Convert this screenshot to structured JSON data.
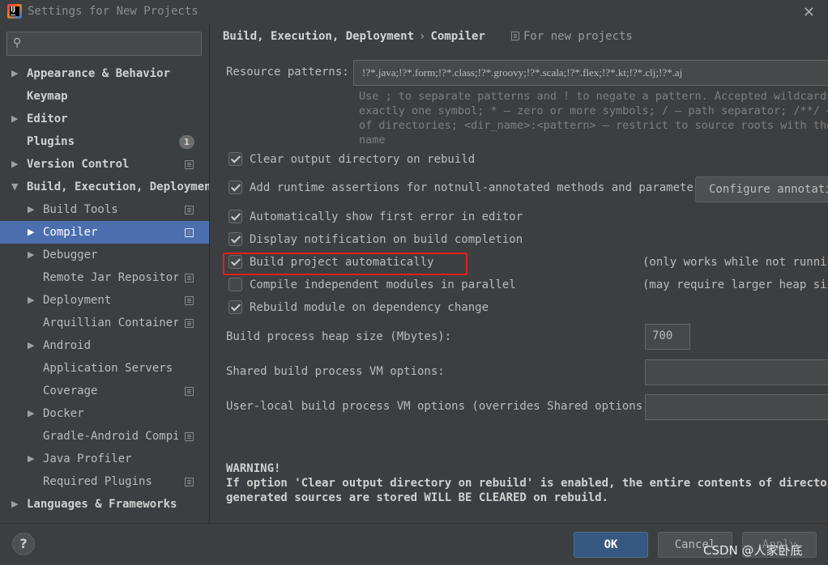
{
  "window": {
    "title": "Settings for New Projects",
    "close_glyph": "✕",
    "app_icon": "intellij-idea-icon"
  },
  "search": {
    "placeholder": "",
    "value": "",
    "icon": "search-icon",
    "icon_glyph": "⚲"
  },
  "sidebar": {
    "items": [
      {
        "label": "Appearance & Behavior",
        "level": 0,
        "arrow": "▶",
        "bold": true
      },
      {
        "label": "Keymap",
        "level": 0,
        "arrow": "",
        "bold": true
      },
      {
        "label": "Editor",
        "level": 0,
        "arrow": "▶",
        "bold": true
      },
      {
        "label": "Plugins",
        "level": 0,
        "arrow": "",
        "bold": true,
        "badge": "1"
      },
      {
        "label": "Version Control",
        "level": 0,
        "arrow": "▶",
        "bold": true,
        "copy_icon": true
      },
      {
        "label": "Build, Execution, Deployment",
        "level": 0,
        "arrow": "▼",
        "bold": true
      },
      {
        "label": "Build Tools",
        "level": 1,
        "arrow": "▶",
        "copy_icon": true
      },
      {
        "label": "Compiler",
        "level": 1,
        "arrow": "▶",
        "copy_icon": true,
        "selected": true
      },
      {
        "label": "Debugger",
        "level": 1,
        "arrow": "▶"
      },
      {
        "label": "Remote Jar Repositories",
        "level": 1,
        "arrow": "",
        "copy_icon": true
      },
      {
        "label": "Deployment",
        "level": 1,
        "arrow": "▶",
        "copy_icon": true
      },
      {
        "label": "Arquillian Containers",
        "level": 1,
        "arrow": "",
        "copy_icon": true
      },
      {
        "label": "Android",
        "level": 1,
        "arrow": "▶"
      },
      {
        "label": "Application Servers",
        "level": 1,
        "arrow": ""
      },
      {
        "label": "Coverage",
        "level": 1,
        "arrow": "",
        "copy_icon": true
      },
      {
        "label": "Docker",
        "level": 1,
        "arrow": "▶"
      },
      {
        "label": "Gradle-Android Compiler",
        "level": 1,
        "arrow": "",
        "copy_icon": true
      },
      {
        "label": "Java Profiler",
        "level": 1,
        "arrow": "▶"
      },
      {
        "label": "Required Plugins",
        "level": 1,
        "arrow": "",
        "copy_icon": true
      },
      {
        "label": "Languages & Frameworks",
        "level": 0,
        "arrow": "▶",
        "bold": true
      }
    ]
  },
  "header": {
    "crumb1": "Build, Execution, Deployment",
    "separator": "›",
    "crumb2": "Compiler",
    "scope": "For new projects"
  },
  "compiler": {
    "resource_patterns_label": "Resource patterns:",
    "resource_patterns_value": "!?*.java;!?*.form;!?*.class;!?*.groovy;!?*.scala;!?*.flex;!?*.kt;!?*.clj;!?*.aj",
    "hint_lines": [
      "Use ; to separate patterns and ! to negate a pattern. Accepted wildcards",
      "exactly one symbol; * — zero or more symbols; / — path separator; /**/ —",
      "of directories; <dir_name>:<pattern> — restrict to source roots with the",
      "name"
    ],
    "options": [
      {
        "label": "Clear output directory on rebuild",
        "checked": true
      },
      {
        "label": "Add runtime assertions for notnull-annotated methods and parameters",
        "checked": true
      },
      {
        "label": "Automatically show first error in editor",
        "checked": true
      },
      {
        "label": "Display notification on build completion",
        "checked": true
      },
      {
        "label": "Build project automatically",
        "checked": true
      },
      {
        "label": "Compile independent modules in parallel",
        "checked": false
      },
      {
        "label": "Rebuild module on dependency change",
        "checked": true
      }
    ],
    "configure_annotations_button": "Configure annotations...",
    "build_auto_note": "(only works while not running / debugging)",
    "parallel_note": "(may require larger heap size)",
    "heap_label": "Build process heap size (Mbytes):",
    "heap_value": "700",
    "shared_vm_label": "Shared build process VM options:",
    "shared_vm_value": "",
    "user_vm_label": "User-local build process VM options (overrides Shared options):",
    "user_vm_value": "",
    "warning_title": "WARNING!",
    "warning_line1": "If option 'Clear output directory on rebuild' is enabled, the entire contents of directories",
    "warning_line2": "generated sources are stored WILL BE CLEARED on rebuild."
  },
  "footer": {
    "help": "?",
    "ok": "OK",
    "cancel": "Cancel",
    "apply": "Apply",
    "watermark": "CSDN @人家卧底"
  },
  "colors": {
    "background": "#3c3f41",
    "selection": "#4b6eaf",
    "primary_button": "#365880",
    "highlight_box": "#e02020"
  }
}
